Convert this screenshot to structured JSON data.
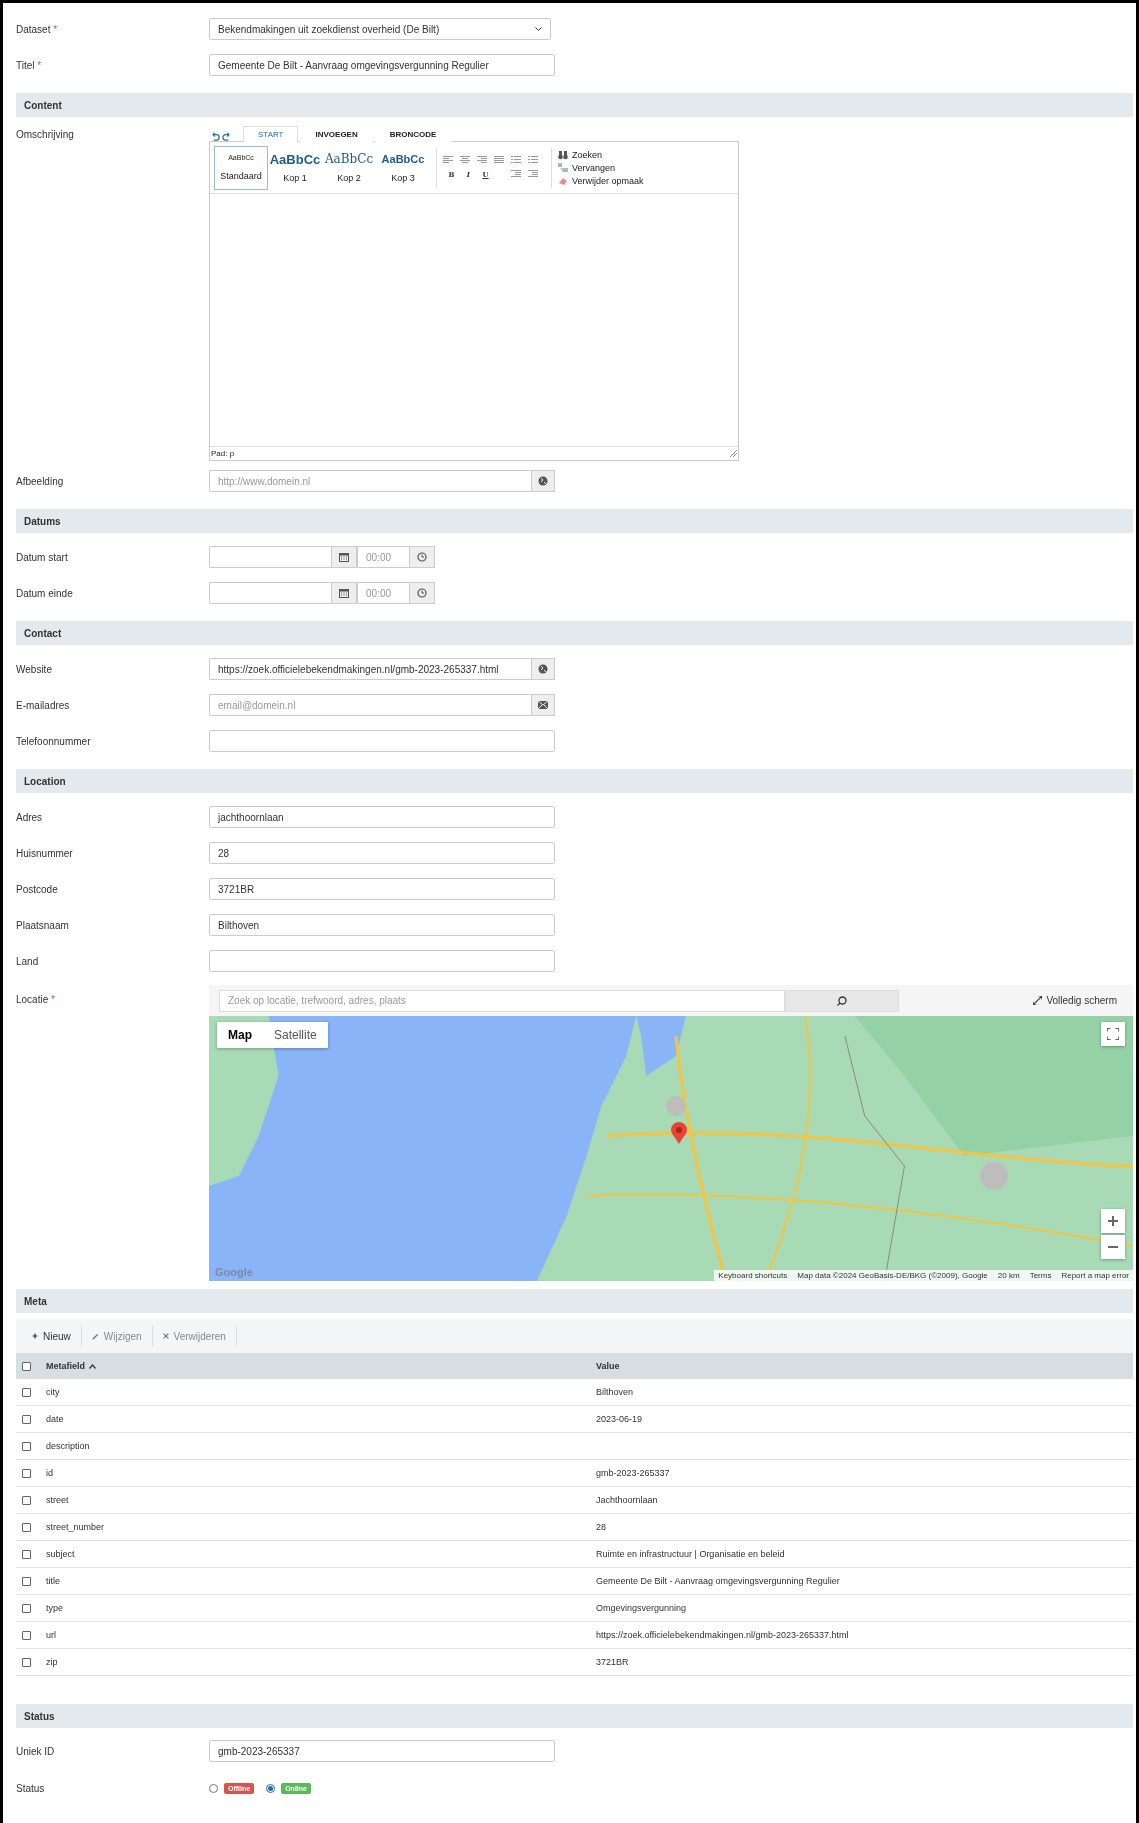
{
  "dataset": {
    "label": "Dataset",
    "required_mark": "*",
    "value": "Bekendmakingen uit zoekdienst overheid (De Bilt)"
  },
  "titel": {
    "label": "Titel",
    "required_mark": "*",
    "value": "Gemeente De Bilt - Aanvraag omgevingsvergunning Regulier"
  },
  "content": {
    "header": "Content",
    "label": "Omschrijving",
    "editor": {
      "tabs": [
        {
          "label": "START",
          "selected": true
        },
        {
          "label": "INVOEGEN",
          "selected": false
        },
        {
          "label": "BRONCODE",
          "selected": false
        }
      ],
      "styles": [
        {
          "kind": "normal",
          "sample": "AaBbCc",
          "label": "Standaard",
          "selected": true
        },
        {
          "kind": "h1",
          "sample": "AaBbCc",
          "label": "Kop 1",
          "selected": false
        },
        {
          "kind": "h2",
          "sample": "AaBbCc",
          "label": "Kop 2",
          "selected": false
        },
        {
          "kind": "h3",
          "sample": "AaBbCc",
          "label": "Kop 3",
          "selected": false
        }
      ],
      "format_buttons": [
        {
          "kind": "bold",
          "label": "B"
        },
        {
          "kind": "italic",
          "label": "I"
        },
        {
          "kind": "underline",
          "label": "U"
        }
      ],
      "tools": [
        {
          "kind": "find",
          "label": "Zoeken"
        },
        {
          "kind": "replace",
          "label": "Vervangen"
        },
        {
          "kind": "clear",
          "label": "Verwijder opmaak"
        }
      ],
      "path": "Pad: p"
    }
  },
  "afbeelding": {
    "label": "Afbeelding",
    "placeholder": "http://www.domein.nl"
  },
  "datums": {
    "header": "Datums",
    "rows": [
      {
        "label": "Datum start",
        "time": "00:00"
      },
      {
        "label": "Datum einde",
        "time": "00:00"
      }
    ]
  },
  "contact": {
    "header": "Contact",
    "fields": [
      {
        "label": "Website",
        "kind": "url",
        "value": "https://zoek.officielebekendmakingen.nl/gmb-2023-265337.html"
      },
      {
        "label": "E-mailadres",
        "kind": "email",
        "placeholder": "email@domein.nl"
      },
      {
        "label": "Telefoonnummer",
        "kind": "text"
      }
    ]
  },
  "location": {
    "header": "Location",
    "fields": [
      {
        "label": "Adres",
        "value": "jachthoornlaan"
      },
      {
        "label": "Huisnummer",
        "value": "28"
      },
      {
        "label": "Postcode",
        "value": "3721BR"
      },
      {
        "label": "Plaatsnaam",
        "value": "Bilthoven"
      },
      {
        "label": "Land"
      }
    ],
    "map": {
      "label": "Locatie",
      "required_mark": "*",
      "search_placeholder": "Zoek op locatie, trefwoord, adres, plaats",
      "fullscreen": "Volledig scherm",
      "map_types": [
        {
          "label": "Map",
          "selected": true
        },
        {
          "label": "Satellite",
          "selected": false
        }
      ],
      "logo": "Google",
      "attribution": [
        "Keyboard shortcuts",
        "Map data ©2024 GeoBasis-DE/BKG (©2009), Google",
        "20 km",
        "Terms",
        "Report a map error"
      ]
    }
  },
  "meta": {
    "header": "Meta",
    "toolbar": [
      {
        "kind": "new",
        "label": "Nieuw",
        "disabled": false
      },
      {
        "kind": "edit",
        "label": "Wijzigen",
        "disabled": true
      },
      {
        "kind": "delete",
        "label": "Verwijderen",
        "disabled": true
      }
    ],
    "select_all": {
      "checked": false
    },
    "columns": [
      {
        "label": "Metafield",
        "sorted": true
      },
      {
        "label": "Value",
        "sorted": false
      }
    ],
    "rows": [
      {
        "field": "city",
        "value": "Bilthoven",
        "checked": false
      },
      {
        "field": "date",
        "value": "2023-06-19",
        "checked": false
      },
      {
        "field": "description",
        "checked": false
      },
      {
        "field": "id",
        "value": "gmb-2023-265337",
        "checked": false
      },
      {
        "field": "street",
        "value": "Jachthoornlaan",
        "checked": false
      },
      {
        "field": "street_number",
        "value": "28",
        "checked": false
      },
      {
        "field": "subject",
        "value": "Ruimte en infrastructuur | Organisatie en beleid",
        "checked": false
      },
      {
        "field": "title",
        "value": "Gemeente De Bilt - Aanvraag omgevingsvergunning Regulier",
        "checked": false
      },
      {
        "field": "type",
        "value": "Omgevingsvergunning",
        "checked": false
      },
      {
        "field": "url",
        "value": "https://zoek.officielebekendmakingen.nl/gmb-2023-265337.html",
        "checked": false
      },
      {
        "field": "zip",
        "value": "3721BR",
        "checked": false
      }
    ]
  },
  "status": {
    "header": "Status",
    "uniek_id": {
      "label": "Uniek ID",
      "value": "gmb-2023-265337"
    },
    "state": {
      "label": "Status",
      "options": [
        {
          "label": "Offline",
          "color": "#d9534f",
          "selected": false
        },
        {
          "label": "Online",
          "color": "#5cb85c",
          "selected": true
        }
      ]
    }
  }
}
